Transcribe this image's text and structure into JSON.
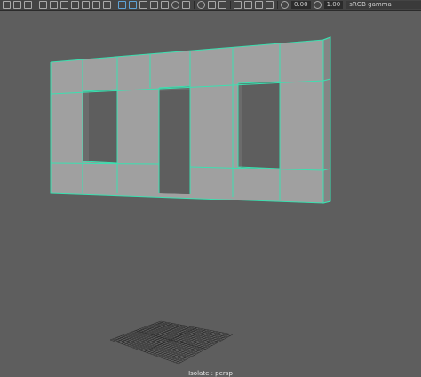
{
  "toolbar": {
    "icons": [
      "select-camera-icon",
      "camera-attributes-icon",
      "bookmark-icon",
      "image-plane-icon",
      "grid-icon",
      "film-gate-icon",
      "resolution-gate-icon",
      "gate-mask-icon",
      "field-chart-icon",
      "safe-action-icon",
      "wireframe-icon",
      "smooth-shade-icon",
      "use-default-material-icon",
      "wireframe-on-shaded-icon",
      "textured-icon",
      "lights-icon",
      "shadows-icon",
      "ambient-occlusion-icon",
      "motion-blur-icon",
      "anti-aliasing-icon",
      "isolate-select-icon",
      "xray-icon",
      "xray-joints-icon",
      "backface-culling-icon",
      "exposure-icon",
      "gamma-icon"
    ],
    "exposure_value": "0.00",
    "gamma_value": "1.00",
    "color_space": "sRGB gamma"
  },
  "viewport": {
    "camera_label": "Isolate : persp"
  },
  "colors": {
    "background": "#5e5e5e",
    "mesh_face": "#a0a0a0",
    "mesh_wire": "#3be0b0",
    "grid": "#2a2a2a"
  }
}
